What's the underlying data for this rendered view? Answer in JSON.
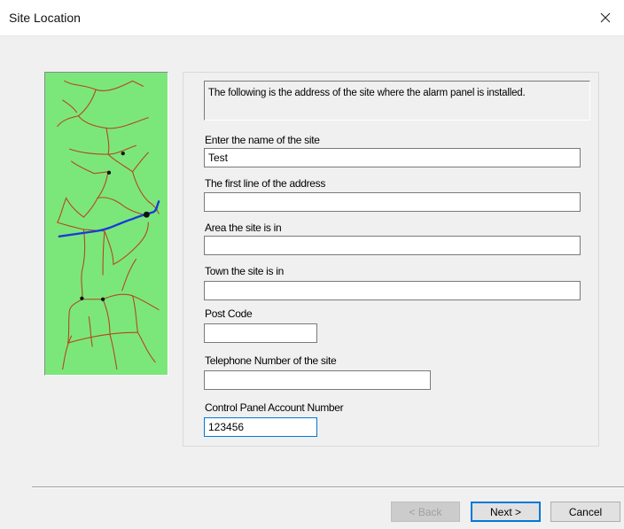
{
  "window": {
    "title": "Site Location"
  },
  "info_text": "The following is the address of the site where the alarm panel is installed.",
  "fields": {
    "site_name": {
      "label": "Enter the name of the site",
      "value": "Test"
    },
    "address_line1": {
      "label": "The first line of the address",
      "value": ""
    },
    "area": {
      "label": "Area the site is in",
      "value": ""
    },
    "town": {
      "label": "Town the site is in",
      "value": ""
    },
    "post_code": {
      "label": "Post Code",
      "value": ""
    },
    "telephone": {
      "label": "Telephone Number of the site",
      "value": ""
    },
    "account_number": {
      "label": "Control Panel Account Number",
      "value": "123456"
    }
  },
  "buttons": {
    "back": "< Back",
    "next": "Next >",
    "cancel": "Cancel"
  },
  "colors": {
    "map_background": "#7be77b",
    "road": "#b5471a",
    "river": "#1a3cd6",
    "focus": "#0078d7"
  }
}
